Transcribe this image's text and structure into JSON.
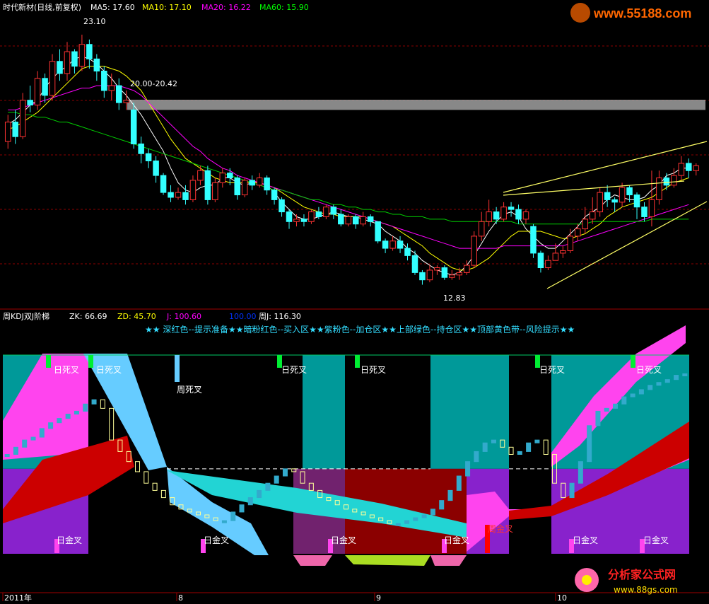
{
  "header": {
    "title": "时代新材(日线,前复权)",
    "ma": [
      {
        "label": "MA5: 17.60",
        "color": "#ffffff"
      },
      {
        "label": "MA10: 17.10",
        "color": "#ffff00"
      },
      {
        "label": "MA20: 16.22",
        "color": "#ff00ff"
      },
      {
        "label": "MA60: 15.90",
        "color": "#00ff00"
      }
    ]
  },
  "watermark": {
    "text": "www.55188.com"
  },
  "lower_header": {
    "title": "周KDJ双J阶梯",
    "zk": "ZK: 66.69",
    "zd": "ZD: 45.70",
    "j": "J: 100.60",
    "hundred": "100.00",
    "zj": "周J: 116.30"
  },
  "legend_text": "★★ 深红色--提示准备★★暗粉红色--买入区★★紫粉色--加仓区★★上部绿色--持仓区★★顶部黄色带--风险提示★★",
  "bottom_logo": {
    "name": "分析家公式网",
    "url": "www.88gs.com"
  },
  "chart_data": [
    {
      "type": "candlestick",
      "title": "时代新材(日线,前复权)",
      "price_labels": {
        "high": "23.10",
        "gap": "20.00-20.42",
        "low": "12.83"
      },
      "ylim": [
        12.0,
        23.8
      ],
      "gap_zone": [
        20.0,
        20.42
      ],
      "candles": [
        [
          18.7,
          19.5,
          18.4,
          19.8
        ],
        [
          19.5,
          18.9,
          18.6,
          20.0
        ],
        [
          18.9,
          20.4,
          18.8,
          20.7
        ],
        [
          20.4,
          20.2,
          19.9,
          21.0
        ],
        [
          20.2,
          21.3,
          20.0,
          21.6
        ],
        [
          21.3,
          20.6,
          20.3,
          21.5
        ],
        [
          20.6,
          22.0,
          20.4,
          22.3
        ],
        [
          22.0,
          21.5,
          21.2,
          22.5
        ],
        [
          21.5,
          22.4,
          21.2,
          22.8
        ],
        [
          22.4,
          21.8,
          21.5,
          22.5
        ],
        [
          21.8,
          22.7,
          21.6,
          23.1
        ],
        [
          22.7,
          22.1,
          21.7,
          22.9
        ],
        [
          22.1,
          21.6,
          21.2,
          22.3
        ],
        [
          21.6,
          20.8,
          20.5,
          21.8
        ],
        [
          20.8,
          21.0,
          20.4,
          21.5
        ],
        [
          21.0,
          20.3,
          20.0,
          21.3
        ],
        [
          20.3,
          20.4,
          20.0,
          20.8
        ],
        [
          20.0,
          18.6,
          18.4,
          20.3
        ],
        [
          18.6,
          18.2,
          17.8,
          18.9
        ],
        [
          18.2,
          17.9,
          17.6,
          18.4
        ],
        [
          17.9,
          17.3,
          17.0,
          18.1
        ],
        [
          17.3,
          16.6,
          16.5,
          17.4
        ],
        [
          16.6,
          16.4,
          16.2,
          16.9
        ],
        [
          16.4,
          16.6,
          16.3,
          16.8
        ],
        [
          16.6,
          16.3,
          16.1,
          16.9
        ],
        [
          16.3,
          17.1,
          16.2,
          17.3
        ],
        [
          17.1,
          17.5,
          16.9,
          17.7
        ],
        [
          17.5,
          16.3,
          16.1,
          17.7
        ],
        [
          16.3,
          17.0,
          16.2,
          17.2
        ],
        [
          17.0,
          17.4,
          16.8,
          17.6
        ],
        [
          17.4,
          17.2,
          16.9,
          17.6
        ],
        [
          17.2,
          16.5,
          16.3,
          17.3
        ],
        [
          16.5,
          17.1,
          16.4,
          17.2
        ],
        [
          17.1,
          16.9,
          16.7,
          17.3
        ],
        [
          16.9,
          17.2,
          16.8,
          17.4
        ],
        [
          17.2,
          16.7,
          16.5,
          17.3
        ],
        [
          16.7,
          16.3,
          16.1,
          16.8
        ],
        [
          16.3,
          15.8,
          15.6,
          16.4
        ],
        [
          15.8,
          15.4,
          15.1,
          15.9
        ],
        [
          15.4,
          15.5,
          15.2,
          15.7
        ],
        [
          15.5,
          15.4,
          15.2,
          15.7
        ],
        [
          15.4,
          15.8,
          15.3,
          15.9
        ],
        [
          15.8,
          15.6,
          15.5,
          16.0
        ],
        [
          15.6,
          16.0,
          15.5,
          16.1
        ],
        [
          16.0,
          15.7,
          15.5,
          16.1
        ],
        [
          15.7,
          15.3,
          15.2,
          15.9
        ],
        [
          15.3,
          15.6,
          15.2,
          15.7
        ],
        [
          15.6,
          15.3,
          15.1,
          15.7
        ],
        [
          15.3,
          15.6,
          15.2,
          15.8
        ],
        [
          15.6,
          15.4,
          15.2,
          15.7
        ],
        [
          15.4,
          14.6,
          14.5,
          15.4
        ],
        [
          14.6,
          14.3,
          14.1,
          14.7
        ],
        [
          14.3,
          14.6,
          14.2,
          14.8
        ],
        [
          14.6,
          14.3,
          14.1,
          14.8
        ],
        [
          14.3,
          14.0,
          13.8,
          14.5
        ],
        [
          14.0,
          13.3,
          13.2,
          14.2
        ],
        [
          13.3,
          13.0,
          12.8,
          13.4
        ],
        [
          13.0,
          13.4,
          12.9,
          13.6
        ],
        [
          13.4,
          13.5,
          13.2,
          13.6
        ],
        [
          13.5,
          13.1,
          13.0,
          13.6
        ],
        [
          13.1,
          13.2,
          13.0,
          13.4
        ],
        [
          13.2,
          13.3,
          13.0,
          13.5
        ],
        [
          13.3,
          13.6,
          13.2,
          13.8
        ],
        [
          13.6,
          14.8,
          13.5,
          15.0
        ],
        [
          14.8,
          15.4,
          14.6,
          15.8
        ],
        [
          15.4,
          15.8,
          15.2,
          16.3
        ],
        [
          15.8,
          15.5,
          15.3,
          16.0
        ],
        [
          15.5,
          16.0,
          15.4,
          16.2
        ],
        [
          16.0,
          15.9,
          15.6,
          16.2
        ],
        [
          15.9,
          15.5,
          15.3,
          16.1
        ],
        [
          15.5,
          15.8,
          15.3,
          15.9
        ],
        [
          15.2,
          14.1,
          13.9,
          15.3
        ],
        [
          14.1,
          13.5,
          13.3,
          14.2
        ],
        [
          13.5,
          13.8,
          13.4,
          14.0
        ],
        [
          13.8,
          14.1,
          13.9,
          14.5
        ],
        [
          14.1,
          14.2,
          13.9,
          14.4
        ],
        [
          14.2,
          14.8,
          14.1,
          15.1
        ],
        [
          14.8,
          15.1,
          14.6,
          15.3
        ],
        [
          15.1,
          15.5,
          14.9,
          16.0
        ],
        [
          15.5,
          15.8,
          15.3,
          16.4
        ],
        [
          15.8,
          16.6,
          15.6,
          16.8
        ],
        [
          16.6,
          16.3,
          16.0,
          16.9
        ],
        [
          16.3,
          16.2,
          15.8,
          16.4
        ],
        [
          16.2,
          16.8,
          16.0,
          17.0
        ],
        [
          16.8,
          16.5,
          16.2,
          16.9
        ],
        [
          16.5,
          16.0,
          15.5,
          16.6
        ],
        [
          16.0,
          15.6,
          15.4,
          16.2
        ],
        [
          15.6,
          16.3,
          15.2,
          17.5
        ],
        [
          16.3,
          17.2,
          16.1,
          17.5
        ],
        [
          17.2,
          16.9,
          16.7,
          17.4
        ],
        [
          16.9,
          17.3,
          16.8,
          17.6
        ],
        [
          17.3,
          17.8,
          17.1,
          18.1
        ],
        [
          17.8,
          17.5,
          17.2,
          18.0
        ],
        [
          17.5,
          17.7,
          17.3,
          17.8
        ]
      ],
      "series": [
        {
          "name": "MA5",
          "color": "#ffffff",
          "values": [
            19.4,
            19.6,
            19.9,
            20.2,
            20.4,
            20.9,
            21.3,
            21.6,
            21.8,
            22.1,
            22.2,
            22.1,
            21.9,
            21.6,
            21.3,
            20.9,
            20.6,
            20.2,
            19.8,
            19.3,
            18.8,
            18.3,
            17.6,
            17.0,
            16.7,
            16.6,
            16.8,
            16.9,
            16.9,
            17.2,
            17.2,
            17.0,
            16.9,
            17.0,
            17.0,
            16.9,
            16.6,
            16.2,
            15.9,
            15.6,
            15.5,
            15.5,
            15.6,
            15.7,
            15.8,
            15.7,
            15.6,
            15.6,
            15.5,
            15.4,
            15.3,
            15.0,
            14.8,
            14.6,
            14.3,
            14.1,
            13.8,
            13.6,
            13.4,
            13.3,
            13.2,
            13.3,
            13.6,
            14.0,
            14.5,
            15.0,
            15.4,
            15.7,
            15.8,
            15.6,
            15.1,
            14.8,
            14.5,
            14.3,
            14.3,
            14.6,
            14.9,
            15.2,
            15.6,
            15.8,
            16.0,
            16.3,
            16.5,
            16.4,
            16.3,
            16.3,
            16.4,
            16.7,
            16.9,
            17.3,
            17.4,
            17.6,
            17.6
          ]
        },
        {
          "name": "MA10",
          "color": "#ffff00",
          "values": [
            19.2,
            19.3,
            19.5,
            19.7,
            19.9,
            20.2,
            20.5,
            20.8,
            21.1,
            21.4,
            21.7,
            21.8,
            21.8,
            21.8,
            21.7,
            21.6,
            21.4,
            21.1,
            20.8,
            20.3,
            19.8,
            19.3,
            18.8,
            18.4,
            18.0,
            17.8,
            17.6,
            17.4,
            17.2,
            17.1,
            17.0,
            17.0,
            17.0,
            17.0,
            17.0,
            16.9,
            16.8,
            16.6,
            16.4,
            16.2,
            16.0,
            15.9,
            15.8,
            15.7,
            15.7,
            15.6,
            15.6,
            15.6,
            15.6,
            15.5,
            15.4,
            15.3,
            15.2,
            15.0,
            14.8,
            14.6,
            14.4,
            14.1,
            13.9,
            13.7,
            13.5,
            13.4,
            13.4,
            13.5,
            13.7,
            13.9,
            14.2,
            14.5,
            14.8,
            15.0,
            15.0,
            15.0,
            15.0,
            14.9,
            14.8,
            14.7,
            14.7,
            14.8,
            14.9,
            15.1,
            15.3,
            15.6,
            15.8,
            16.0,
            16.1,
            16.2,
            16.3,
            16.4,
            16.6,
            16.8,
            17.0,
            17.1,
            17.2
          ]
        },
        {
          "name": "MA20",
          "color": "#ff00ff",
          "values": [
            20.0,
            20.0,
            20.1,
            20.2,
            20.3,
            20.4,
            20.5,
            20.6,
            20.7,
            20.8,
            20.9,
            20.9,
            21.0,
            21.0,
            21.0,
            21.0,
            20.9,
            20.8,
            20.6,
            20.3,
            20.0,
            19.7,
            19.4,
            19.1,
            18.8,
            18.5,
            18.3,
            18.0,
            17.8,
            17.6,
            17.5,
            17.3,
            17.2,
            17.1,
            17.0,
            16.9,
            16.8,
            16.7,
            16.6,
            16.5,
            16.4,
            16.3,
            16.2,
            16.1,
            16.0,
            15.9,
            15.8,
            15.7,
            15.6,
            15.5,
            15.4,
            15.3,
            15.2,
            15.1,
            15.0,
            14.9,
            14.8,
            14.7,
            14.6,
            14.5,
            14.4,
            14.3,
            14.3,
            14.3,
            14.3,
            14.3,
            14.3,
            14.4,
            14.4,
            14.4,
            14.4,
            14.4,
            14.4,
            14.4,
            14.4,
            14.4,
            14.5,
            14.6,
            14.7,
            14.8,
            14.9,
            15.0,
            15.1,
            15.2,
            15.3,
            15.4,
            15.5,
            15.6,
            15.7,
            15.8,
            15.9,
            16.0,
            16.1
          ]
        },
        {
          "name": "MA60",
          "color": "#00cc00",
          "values": [
            19.9,
            19.9,
            19.8,
            19.8,
            19.7,
            19.7,
            19.6,
            19.5,
            19.5,
            19.4,
            19.3,
            19.2,
            19.1,
            19.0,
            18.9,
            18.8,
            18.7,
            18.6,
            18.5,
            18.4,
            18.3,
            18.2,
            18.1,
            18.0,
            17.9,
            17.8,
            17.7,
            17.6,
            17.5,
            17.4,
            17.3,
            17.2,
            17.1,
            17.0,
            16.9,
            16.8,
            16.7,
            16.7,
            16.6,
            16.5,
            16.4,
            16.3,
            16.3,
            16.2,
            16.1,
            16.1,
            16.0,
            16.0,
            15.9,
            15.9,
            15.8,
            15.8,
            15.7,
            15.7,
            15.6,
            15.6,
            15.6,
            15.5,
            15.5,
            15.5,
            15.4,
            15.4,
            15.4,
            15.4,
            15.4,
            15.4,
            15.4,
            15.4,
            15.4,
            15.3,
            15.3,
            15.3,
            15.3,
            15.3,
            15.3,
            15.3,
            15.3,
            15.3,
            15.3,
            15.4,
            15.4,
            15.4,
            15.4,
            15.4,
            15.4,
            15.4,
            15.4,
            15.5,
            15.5,
            15.5,
            15.5,
            15.5,
            15.5
          ]
        }
      ]
    },
    {
      "type": "bar",
      "title": "周KDJ双J阶梯",
      "ylim": [
        -10,
        130
      ],
      "reference_line": 50,
      "x_labels": [
        "2011年",
        "8",
        "9",
        "10"
      ],
      "cross_labels": [
        "日死叉",
        "周死叉",
        "日金叉",
        "周金叉"
      ],
      "j_values": [
        60,
        65,
        70,
        72,
        78,
        82,
        85,
        88,
        90,
        95,
        98,
        92,
        70,
        62,
        55,
        48,
        40,
        35,
        30,
        25,
        22,
        20,
        18,
        16,
        14,
        14,
        20,
        25,
        30,
        35,
        40,
        45,
        50,
        48,
        40,
        35,
        30,
        28,
        25,
        22,
        20,
        18,
        16,
        14,
        12,
        12,
        14,
        16,
        18,
        22,
        28,
        35,
        45,
        55,
        62,
        68,
        70,
        65,
        60,
        62,
        68,
        70,
        60,
        40,
        30,
        40,
        55,
        80,
        90,
        92,
        95,
        100,
        102,
        105,
        108,
        110,
        112,
        115,
        116
      ]
    }
  ]
}
